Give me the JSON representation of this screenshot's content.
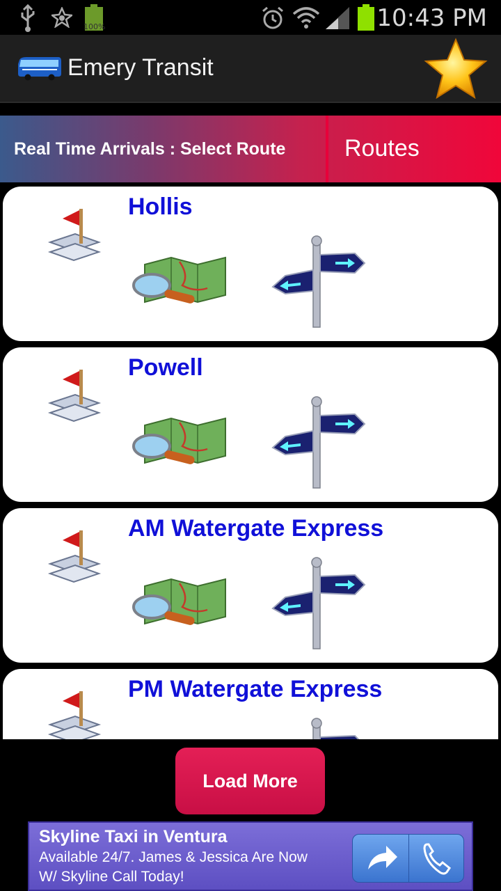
{
  "status_bar": {
    "time": "10:43 PM",
    "battery_small_label": "100%",
    "icons": [
      "usb-icon",
      "star-notification-icon",
      "battery-full-icon",
      "alarm-icon",
      "wifi-icon",
      "signal-icon",
      "battery-icon"
    ]
  },
  "app_bar": {
    "title": "Emery Transit",
    "icons": [
      "bus-icon",
      "favorite-star-icon"
    ]
  },
  "tabs": {
    "active": "Real Time Arrivals : Select Route",
    "other": "Routes"
  },
  "routes": [
    {
      "name": "Hollis"
    },
    {
      "name": "Powell"
    },
    {
      "name": "AM Watergate Express"
    },
    {
      "name": "PM Watergate Express"
    }
  ],
  "route_icons": [
    "flag-icon",
    "map-icon",
    "signpost-icon"
  ],
  "load_more": {
    "label": "Load More"
  },
  "ad": {
    "title": "Skyline Taxi in Ventura",
    "line1": "Available 24/7. James & Jessica Are Now",
    "line2": "W/ Skyline Call Today!",
    "icons": [
      "share-arrow-icon",
      "phone-icon"
    ]
  },
  "colors": {
    "route_name": "#1010d8",
    "tab_gradient_start": "#3b5a8c",
    "tab_gradient_end": "#f0063a",
    "load_more": "#d4144b",
    "ad_background": "#6b5dcf"
  }
}
